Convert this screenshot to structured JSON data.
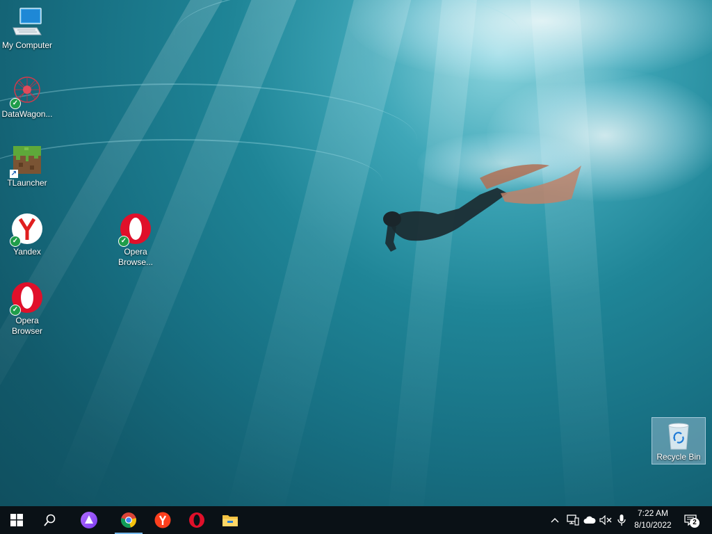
{
  "desktop": {
    "wallpaper": "underwater-diver",
    "icons": [
      {
        "label": "My Computer",
        "icon": "computer-icon",
        "status": "none"
      },
      {
        "label": "DataWagon...",
        "icon": "datawagon-icon",
        "status": "synced"
      },
      {
        "label": "TLauncher",
        "icon": "minecraft-block-icon",
        "status": "shortcut"
      },
      {
        "label": "Yandex",
        "icon": "yandex-browser-icon",
        "status": "synced"
      },
      {
        "label": "Opera Browse...",
        "icon": "opera-icon",
        "status": "synced"
      },
      {
        "label": "Opera Browser",
        "icon": "opera-icon",
        "status": "synced"
      },
      {
        "label": "Recycle Bin",
        "icon": "recycle-bin-icon",
        "status": "selected"
      }
    ]
  },
  "taskbar": {
    "start": "windows-start-icon",
    "search": "search-icon",
    "pinned": [
      "alice-assistant-icon",
      "chrome-icon",
      "yandex-browser-icon",
      "opera-icon",
      "file-explorer-icon"
    ],
    "tray": [
      "chevron-up-icon",
      "network-icon",
      "onedrive-cloud-icon",
      "speaker-muted-icon",
      "microphone-icon"
    ],
    "clock": {
      "time": "7:22 AM",
      "date": "8/10/2022"
    },
    "notification_count": "2"
  },
  "colors": {
    "taskbar_bg": "#0a1116",
    "opera_red": "#e0102a",
    "yandex_red": "#fc3f1d",
    "check_green": "#1f9d4a"
  }
}
